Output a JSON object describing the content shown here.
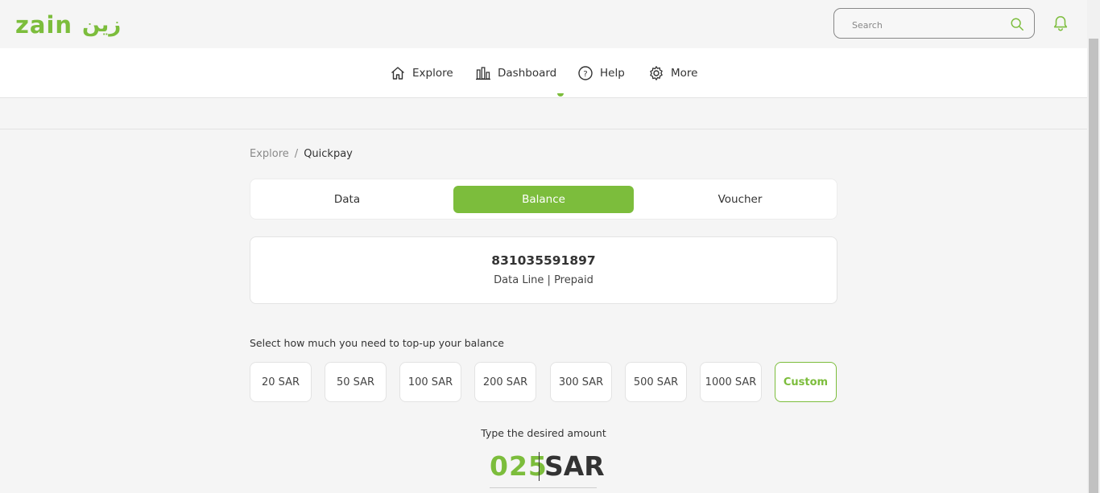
{
  "header": {
    "logo_latin": "zain",
    "logo_arabic": "زين",
    "search_placeholder": "Search",
    "search_value": ""
  },
  "nav": {
    "items": [
      {
        "label": "Explore",
        "icon": "home-icon"
      },
      {
        "label": "Dashboard",
        "icon": "bar-chart-icon"
      },
      {
        "label": "Help",
        "icon": "help-circle-icon"
      },
      {
        "label": "More",
        "icon": "gear-icon"
      }
    ]
  },
  "breadcrumb": {
    "items": [
      "Explore",
      "Quickpay"
    ],
    "separator": "/"
  },
  "tabs": {
    "items": [
      "Data",
      "Balance",
      "Voucher"
    ],
    "active": "Balance"
  },
  "account": {
    "number": "831035591897",
    "type": "Data Line | Prepaid"
  },
  "topup": {
    "prompt": "Select how much you need to top-up your balance",
    "amounts": [
      "20 SAR",
      "50 SAR",
      "100 SAR",
      "200 SAR",
      "300 SAR",
      "500 SAR",
      "1000 SAR",
      "Custom"
    ],
    "selected": "Custom",
    "type_label": "Type the desired amount",
    "amount_value": "025",
    "currency": "SAR"
  },
  "colors": {
    "brand_green": "#7cbd3c",
    "background": "#f5f5f5",
    "text": "#333333"
  }
}
